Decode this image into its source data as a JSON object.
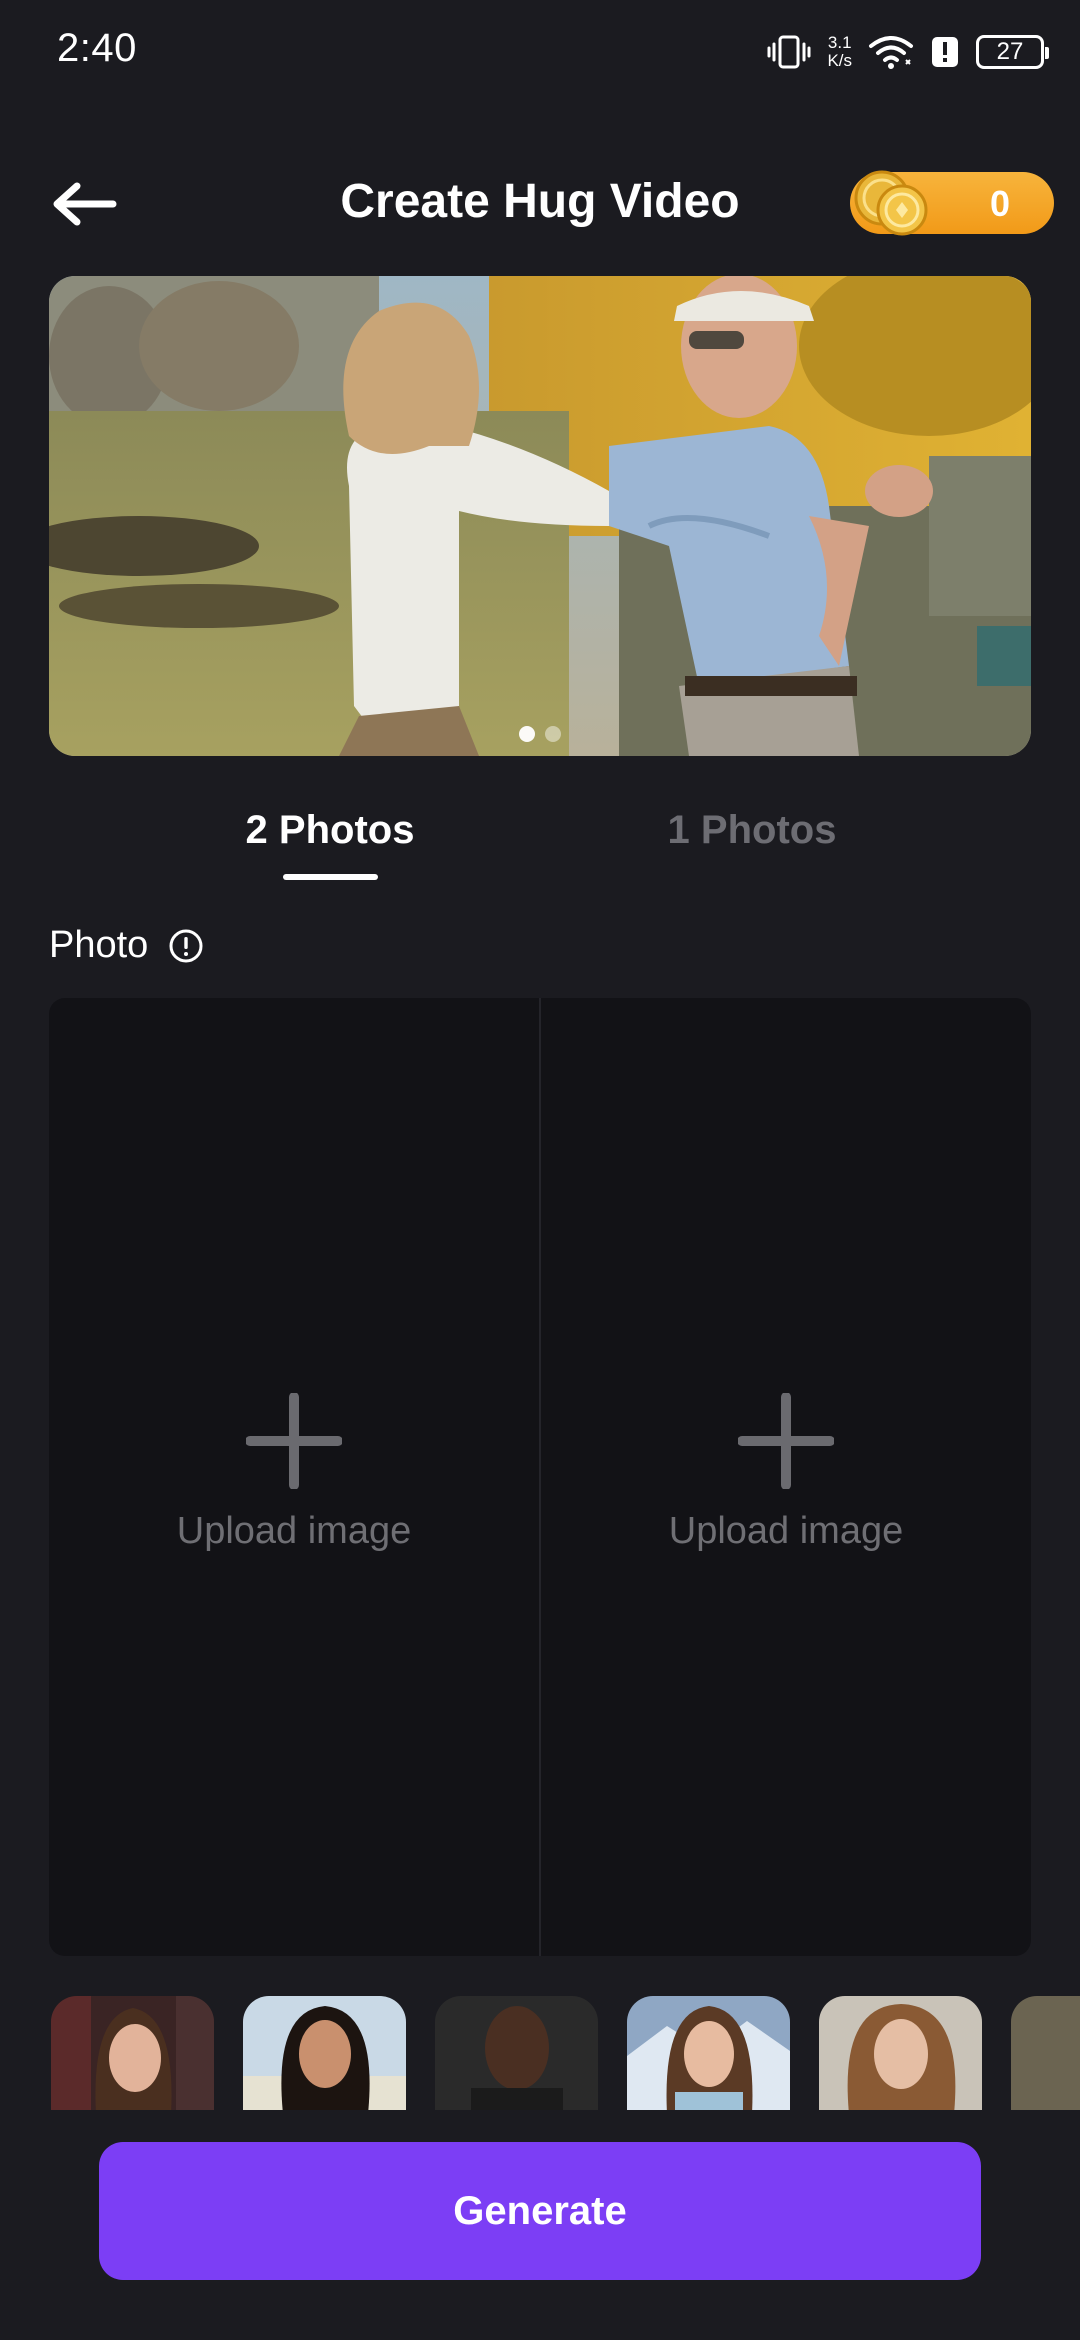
{
  "status_bar": {
    "time": "2:40",
    "net_speed_value": "3.1",
    "net_speed_unit": "K/s",
    "battery_level": "27",
    "icons": [
      "vibrate-icon",
      "wifi-icon",
      "alert-icon",
      "battery-icon"
    ]
  },
  "header": {
    "title": "Create Hug Video",
    "coin_balance": "0",
    "back_icon": "arrow-left-icon",
    "coin_icon": "coin-stack-icon"
  },
  "hero": {
    "slide_count": 2,
    "active_slide": 1
  },
  "tabs": [
    {
      "label": "2 Photos",
      "active": true
    },
    {
      "label": "1 Photos",
      "active": false
    }
  ],
  "photo_section": {
    "label": "Photo",
    "info_icon": "info-icon",
    "slots": [
      {
        "label": "Upload image",
        "icon": "plus-icon"
      },
      {
        "label": "Upload image",
        "icon": "plus-icon"
      }
    ]
  },
  "sample_photos": {
    "count_visible": 6
  },
  "generate": {
    "label": "Generate"
  },
  "colors": {
    "background": "#1b1b20",
    "upload_area": "#121216",
    "accent": "#7c3ef5",
    "coin_gold": "#f29a18",
    "muted_text": "#6f6f74"
  }
}
